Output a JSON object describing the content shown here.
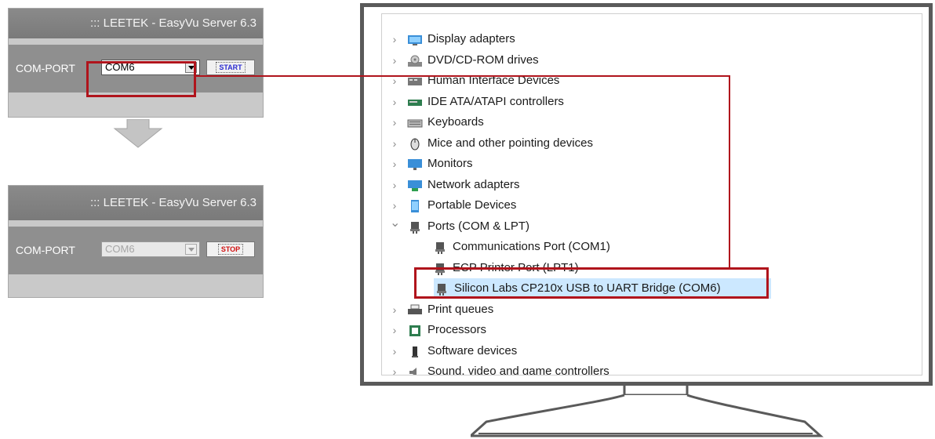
{
  "panel_before": {
    "title": "::: LEETEK - EasyVu Server 6.3",
    "com_label": "COM-PORT",
    "com_value": "COM6",
    "button_label": "START"
  },
  "panel_after": {
    "title": "::: LEETEK - EasyVu Server 6.3",
    "com_label": "COM-PORT",
    "com_value": "COM6",
    "button_label": "STOP"
  },
  "device_manager": {
    "top_partial": "",
    "items": [
      {
        "label": "Display adapters",
        "icon": "display-adapter-icon",
        "expanded": false
      },
      {
        "label": "DVD/CD-ROM drives",
        "icon": "dvd-drive-icon",
        "expanded": false
      },
      {
        "label": "Human Interface Devices",
        "icon": "hid-icon",
        "expanded": false
      },
      {
        "label": "IDE ATA/ATAPI controllers",
        "icon": "ide-controller-icon",
        "expanded": false
      },
      {
        "label": "Keyboards",
        "icon": "keyboard-icon",
        "expanded": false
      },
      {
        "label": "Mice and other pointing devices",
        "icon": "mouse-icon",
        "expanded": false
      },
      {
        "label": "Monitors",
        "icon": "monitor-icon",
        "expanded": false
      },
      {
        "label": "Network adapters",
        "icon": "network-adapter-icon",
        "expanded": false
      },
      {
        "label": "Portable Devices",
        "icon": "portable-device-icon",
        "expanded": false
      },
      {
        "label": "Ports (COM & LPT)",
        "icon": "port-icon",
        "expanded": true
      },
      {
        "label": "Print queues",
        "icon": "printer-icon",
        "expanded": false
      },
      {
        "label": "Processors",
        "icon": "processor-icon",
        "expanded": false
      },
      {
        "label": "Software devices",
        "icon": "software-device-icon",
        "expanded": false
      },
      {
        "label": "Sound, video and game controllers",
        "icon": "sound-icon",
        "expanded": false
      }
    ],
    "port_children": [
      {
        "label": "Communications Port (COM1)"
      },
      {
        "label": "ECP Printer Port (LPT1)"
      },
      {
        "label": "Silicon Labs CP210x USB to UART Bridge (COM6)",
        "selected": true
      }
    ]
  },
  "colors": {
    "highlight": "#b0141c",
    "panel_gray": "#8f8f8f",
    "start_text": "#2a2ad0",
    "stop_text": "#d01010",
    "selection": "#cce8ff"
  }
}
